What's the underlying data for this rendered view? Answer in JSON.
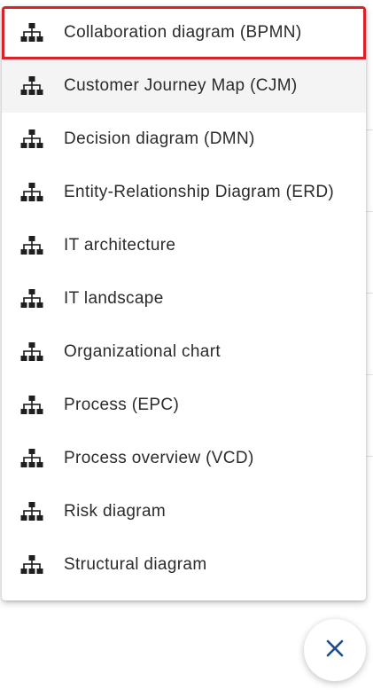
{
  "menu": {
    "items": [
      {
        "label": "Collaboration diagram (BPMN)",
        "icon": "hierarchy-icon",
        "selected": true
      },
      {
        "label": "Customer Journey Map (CJM)",
        "icon": "hierarchy-icon",
        "hovered": true
      },
      {
        "label": "Decision diagram (DMN)",
        "icon": "hierarchy-icon"
      },
      {
        "label": "Entity-Relationship Diagram (ERD)",
        "icon": "hierarchy-icon"
      },
      {
        "label": "IT architecture",
        "icon": "hierarchy-icon"
      },
      {
        "label": "IT landscape",
        "icon": "hierarchy-icon"
      },
      {
        "label": "Organizational chart",
        "icon": "hierarchy-icon"
      },
      {
        "label": "Process (EPC)",
        "icon": "hierarchy-icon"
      },
      {
        "label": "Process overview (VCD)",
        "icon": "hierarchy-icon"
      },
      {
        "label": "Risk diagram",
        "icon": "hierarchy-icon"
      },
      {
        "label": "Structural diagram",
        "icon": "hierarchy-icon"
      }
    ]
  },
  "fab": {
    "icon": "close-icon"
  },
  "colors": {
    "selection_outline": "#d9222a",
    "hover_background": "#f4f4f4",
    "text": "#2b2b2b",
    "icon": "#1f1f1f",
    "close_icon": "#1e4f8c"
  }
}
